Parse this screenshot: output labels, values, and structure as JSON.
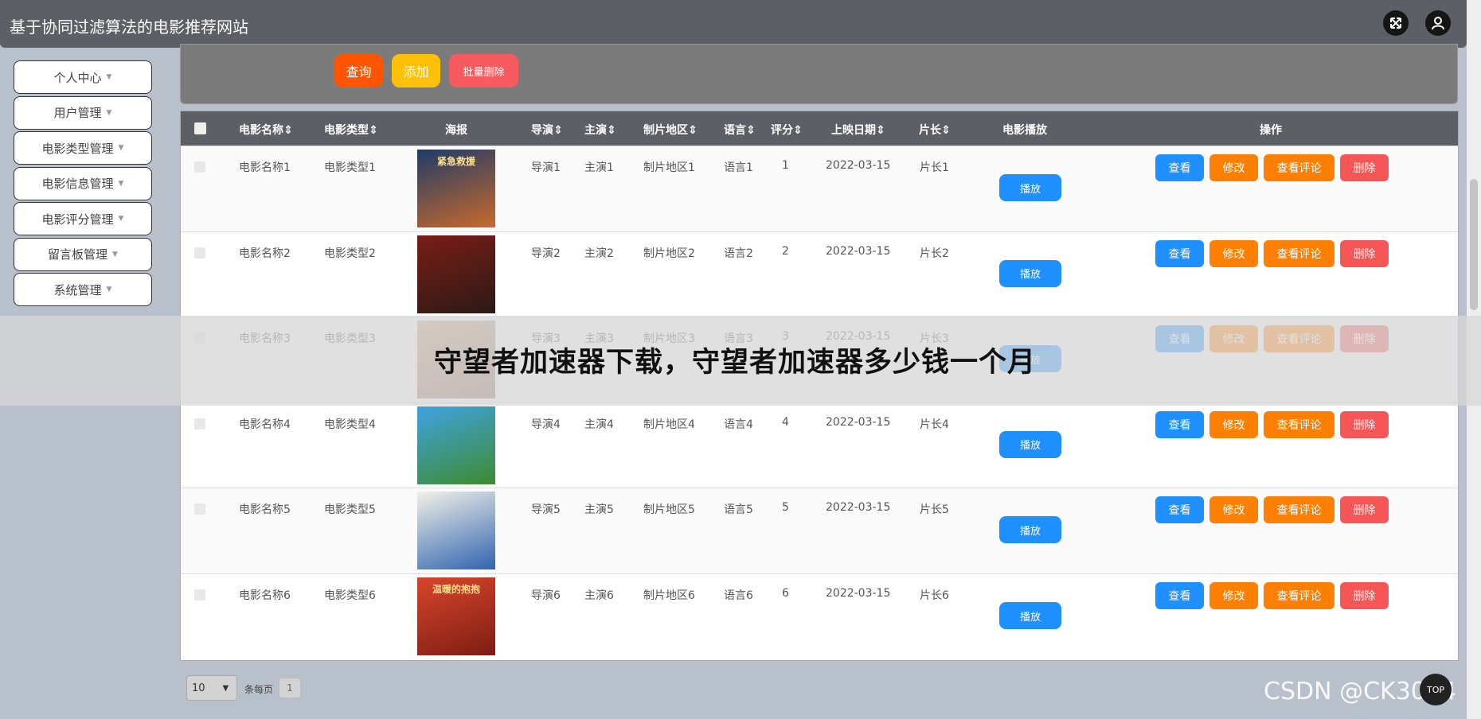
{
  "header": {
    "title": "基于协同过滤算法的电影推荐网站",
    "icons": [
      "fullscreen-icon",
      "user-icon"
    ]
  },
  "sidebar": {
    "items": [
      {
        "label": "个人中心"
      },
      {
        "label": "用户管理"
      },
      {
        "label": "电影类型管理"
      },
      {
        "label": "电影信息管理"
      },
      {
        "label": "电影评分管理"
      },
      {
        "label": "留言板管理"
      },
      {
        "label": "系统管理"
      }
    ]
  },
  "toolbar": {
    "query_label": "查询",
    "add_label": "添加",
    "batch_delete_label": "批量删除"
  },
  "table": {
    "headers": {
      "name": "电影名称",
      "type": "电影类型",
      "poster": "海报",
      "director": "导演",
      "actor": "主演",
      "region": "制片地区",
      "language": "语言",
      "rating": "评分",
      "date": "上映日期",
      "length": "片长",
      "play": "电影播放",
      "ops": "操作"
    },
    "rows": [
      {
        "name": "电影名称1",
        "type": "电影类型1",
        "director": "导演1",
        "actor": "主演1",
        "region": "制片地区1",
        "language": "语言1",
        "rating": "1",
        "date": "2022-03-15",
        "length": "片长1",
        "poster_title": "紧急救援",
        "poster_colors": [
          "#1f3b66",
          "#c96a2b"
        ]
      },
      {
        "name": "电影名称2",
        "type": "电影类型2",
        "director": "导演2",
        "actor": "主演2",
        "region": "制片地区2",
        "language": "语言2",
        "rating": "2",
        "date": "2022-03-15",
        "length": "片长2",
        "poster_title": "",
        "poster_colors": [
          "#7a1d17",
          "#2b1a16"
        ]
      },
      {
        "name": "电影名称3",
        "type": "电影类型3",
        "director": "导演3",
        "actor": "主演3",
        "region": "制片地区3",
        "language": "语言3",
        "rating": "3",
        "date": "2022-03-15",
        "length": "片长3",
        "poster_title": "",
        "poster_colors": [
          "#c9a58a",
          "#8f6b5a"
        ]
      },
      {
        "name": "电影名称4",
        "type": "电影类型4",
        "director": "导演4",
        "actor": "主演4",
        "region": "制片地区4",
        "language": "语言4",
        "rating": "4",
        "date": "2022-03-15",
        "length": "片长4",
        "poster_title": "",
        "poster_colors": [
          "#3fa3e0",
          "#3e8b2f"
        ]
      },
      {
        "name": "电影名称5",
        "type": "电影类型5",
        "director": "导演5",
        "actor": "主演5",
        "region": "制片地区5",
        "language": "语言5",
        "rating": "5",
        "date": "2022-03-15",
        "length": "片长5",
        "poster_title": "",
        "poster_colors": [
          "#f3f1e8",
          "#2f64b0"
        ]
      },
      {
        "name": "电影名称6",
        "type": "电影类型6",
        "director": "导演6",
        "actor": "主演6",
        "region": "制片地区6",
        "language": "语言6",
        "rating": "6",
        "date": "2022-03-15",
        "length": "片长6",
        "poster_title": "温暖的抱抱",
        "poster_colors": [
          "#d8452b",
          "#7d1d14"
        ]
      }
    ],
    "play_label": "播放",
    "ops": {
      "view": "查看",
      "edit": "修改",
      "reviews": "查看评论",
      "delete": "删除"
    }
  },
  "overlay": {
    "text": "守望者加速器下载，守望者加速器多少钱一个月"
  },
  "pagination": {
    "page_size": "10",
    "label": "条每页",
    "current_page": "1"
  },
  "watermark": "CSDN @CK3034",
  "scroll_top_label": "TOP",
  "colors": {
    "header": "#5c5f66",
    "query": "#ff5500",
    "add": "#ffc107",
    "batch_delete": "#f75b5f",
    "view": "#1e90ff",
    "edit": "#ff7f00",
    "delete": "#f75656"
  }
}
